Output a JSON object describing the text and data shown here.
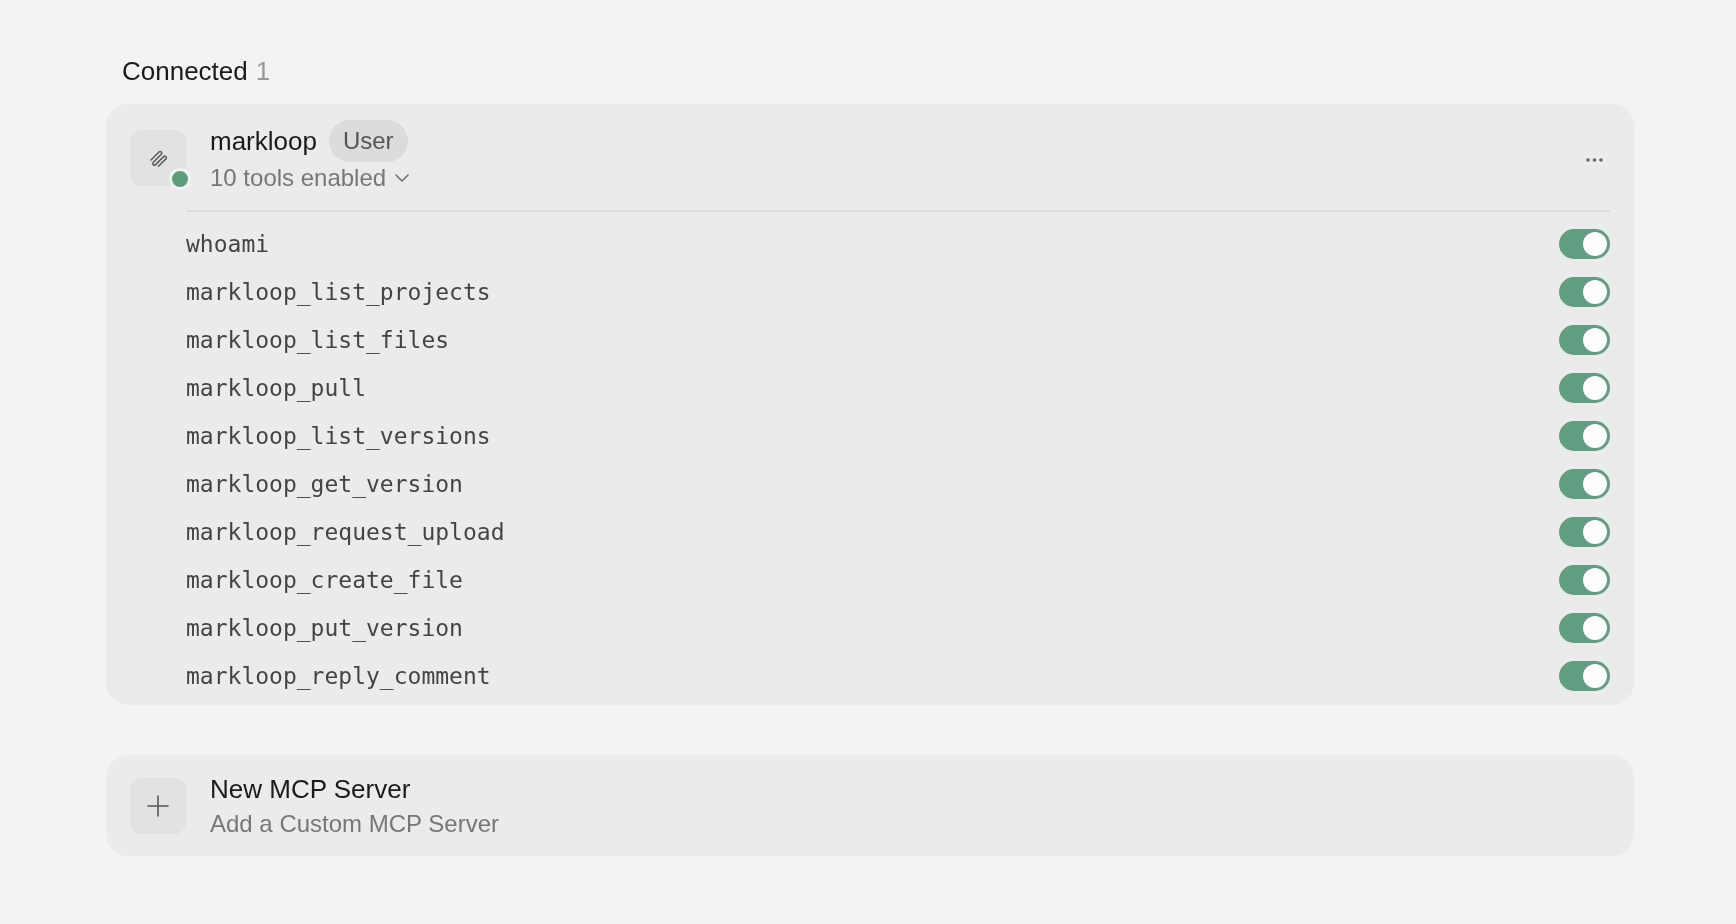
{
  "section": {
    "title": "Connected",
    "count": "1"
  },
  "servers": [
    {
      "name": "markloop",
      "badge": "User",
      "connected": true,
      "tools_summary": "10 tools enabled",
      "expanded": true,
      "tools": [
        {
          "name": "whoami",
          "enabled": true
        },
        {
          "name": "markloop_list_projects",
          "enabled": true
        },
        {
          "name": "markloop_list_files",
          "enabled": true
        },
        {
          "name": "markloop_pull",
          "enabled": true
        },
        {
          "name": "markloop_list_versions",
          "enabled": true
        },
        {
          "name": "markloop_get_version",
          "enabled": true
        },
        {
          "name": "markloop_request_upload",
          "enabled": true
        },
        {
          "name": "markloop_create_file",
          "enabled": true
        },
        {
          "name": "markloop_put_version",
          "enabled": true
        },
        {
          "name": "markloop_reply_comment",
          "enabled": true
        }
      ]
    }
  ],
  "new_server": {
    "title": "New MCP Server",
    "subtitle": "Add a Custom MCP Server"
  }
}
